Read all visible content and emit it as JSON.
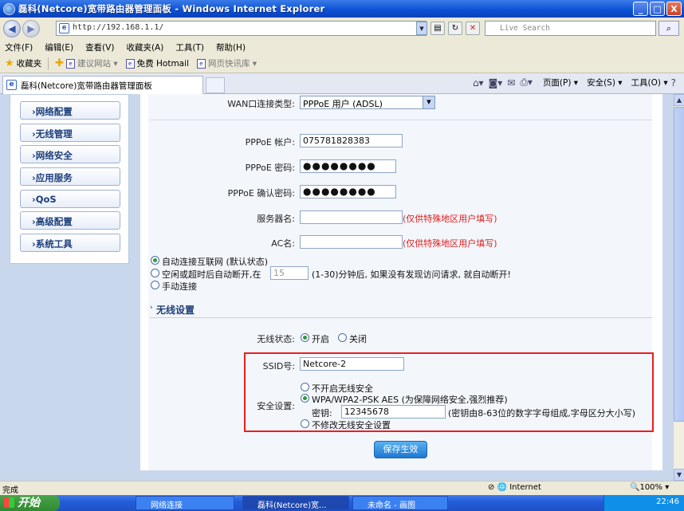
{
  "window": {
    "title": "磊科(Netcore)宽带路由器管理面板 - Windows Internet Explorer",
    "controls": [
      "_",
      "□",
      "X"
    ]
  },
  "address_bar": {
    "url": "http://192.168.1.1/",
    "search_placeholder": "Live Search"
  },
  "menu": [
    "文件(F)",
    "编辑(E)",
    "查看(V)",
    "收藏夹(A)",
    "工具(T)",
    "帮助(H)"
  ],
  "favorites_bar": {
    "label": "收藏夹",
    "items": [
      "建议网站 ▾",
      "免费 Hotmail",
      "网页快讯库 ▾"
    ]
  },
  "tab": {
    "title": "磊科(Netcore)宽带路由器管理面板"
  },
  "command_bar": {
    "page": "页面(P) ▾",
    "safety": "安全(S) ▾",
    "tools": "工具(O) ▾",
    "help": "?"
  },
  "sidebar": {
    "items": [
      {
        "label": "›网络配置"
      },
      {
        "label": "›无线管理"
      },
      {
        "label": "›网络安全"
      },
      {
        "label": "›应用服务"
      },
      {
        "label": "›QoS"
      },
      {
        "label": "›高级配置"
      },
      {
        "label": "›系统工具"
      }
    ]
  },
  "wan": {
    "type_label": "WAN口连接类型:",
    "type_value": "PPPoE 用户 (ADSL)",
    "account_label": "PPPoE 帐户:",
    "account_value": "075781828383",
    "password_label": "PPPoE 密码:",
    "password_value": "●●●●●●●●",
    "confirm_label": "PPPoE 确认密码:",
    "confirm_value": "●●●●●●●●",
    "server_label": "服务器名:",
    "server_hint": "(仅供特殊地区用户填写)",
    "ac_label": "AC名:",
    "ac_hint": "(仅供特殊地区用户填写)",
    "connect_options": {
      "auto": "自动连接互联网 (默认状态)",
      "idle_prefix": "空闲或超时后自动断开,在",
      "idle_value": "15",
      "idle_suffix": "(1-30)分钟后, 如果没有发现访问请求, 就自动断开!",
      "manual": "手动连接"
    }
  },
  "wireless": {
    "section_title": "无线设置",
    "status_label": "无线状态:",
    "status_on": "开启",
    "status_off": "关闭",
    "ssid_label": "SSID号:",
    "ssid_value": "Netcore-2",
    "security_label": "安全设置:",
    "sec_none": "不开启无线安全",
    "sec_wpa": "WPA/WPA2-PSK AES (为保障网络安全,强烈推荐)",
    "key_label": "密钥:",
    "key_value": "12345678",
    "key_hint": "(密钥由8-63位的数字字母组成,字母区分大小写)",
    "sec_keep": "不修改无线安全设置"
  },
  "save_button": "保存生效",
  "status_bar": {
    "done": "完成",
    "zone": "Internet",
    "zoom": "100%"
  },
  "taskbar": {
    "start": "开始",
    "tasks": [
      "网络连接",
      "磊科(Netcore)宽...",
      "未命名 - 画图"
    ],
    "clock": "22:46"
  },
  "colors": {
    "accent_red": "#e82020",
    "panel_bg": "#c9d7ec",
    "link_blue": "#1d3e7a"
  }
}
